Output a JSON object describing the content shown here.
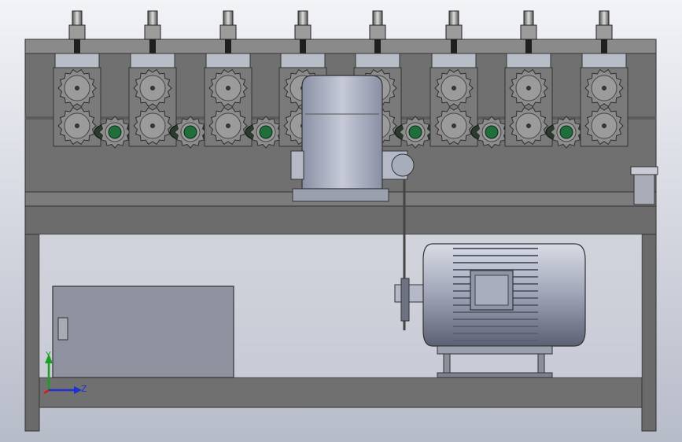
{
  "viewport": {
    "background_top": "#f2f3f7",
    "background_bottom": "#b7bcc9"
  },
  "colors": {
    "frame": "#6a6a6a",
    "frame_dark": "#3a3a3a",
    "metal": "#9aa0ad",
    "metal_light": "#c8ccd6",
    "bearing": "#1f6e3c",
    "motor": "#a7adbf",
    "axis_x": "#e0141e",
    "axis_y": "#18a020",
    "axis_z": "#1f2fd0"
  },
  "triad": {
    "y_label": "Y",
    "z_label": "Z"
  }
}
